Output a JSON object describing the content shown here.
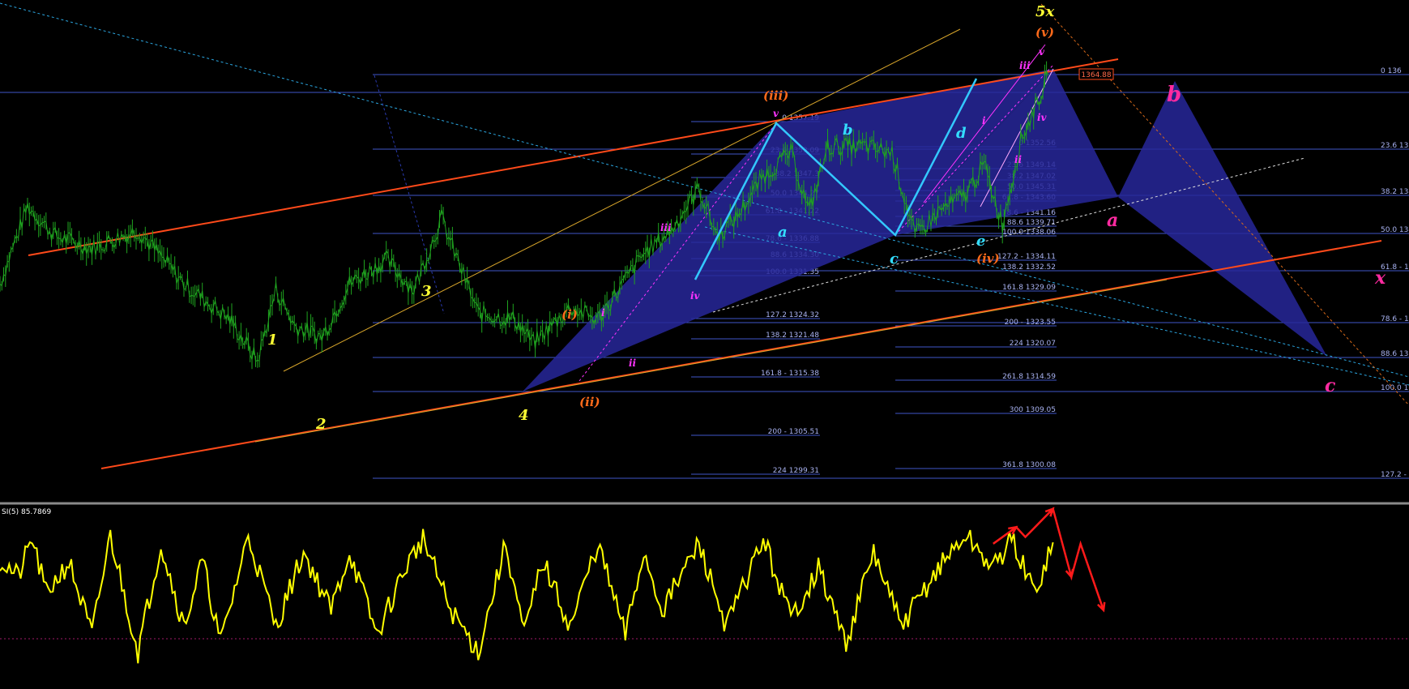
{
  "indicator": {
    "label": "SI(5) 85.7869"
  },
  "price_tag": "1364.88",
  "colors": {
    "background": "#000000",
    "candles": "#1fa31f",
    "trendline": "#ff4a1a",
    "channel": "#d9a62b",
    "fib": "#3f56c8",
    "fib_text": "#a9b3f2",
    "harmonic_fill": "#27279a",
    "zigzag": "#33c8ff",
    "rsi": "#ffff00",
    "forecast": "#ff1a1a",
    "wave_primary": "#ffff33",
    "wave_minor": "#ff6a1a",
    "wave_minute": "#ff33ff",
    "wave_abc": "#33ddff",
    "wave_xabc": "#ff2aa0"
  },
  "fib_right": {
    "labels": [
      "0 136",
      "23.6 135",
      "38.2 134",
      "50.0 134",
      "61.8 - 133",
      "78.6 - 132",
      "88.6 13",
      "100.0 132",
      "127.2 - 129"
    ]
  },
  "fib_set1": {
    "labels": [
      "0 1357.19",
      "23.6 1353.09",
      "38.2 1347.3",
      "50.0 1344.27",
      "61.8 - 1341.22",
      "78.6 - 1336.88",
      "88.6 1334.30",
      "100.0 1331.35",
      "127.2 1324.32",
      "138.2 1321.48",
      "161.8 - 1315.38",
      "200 - 1305.51",
      "224 1299.31"
    ]
  },
  "fib_set2": {
    "labels": [
      "0 1352.56",
      "23.6 1349.14",
      "38.2 1347.02",
      "50.0 1345.31",
      "61.8 - 1343.60",
      "78.6 - 1341.16",
      "88.6 1339.71",
      "100.0 1338.06",
      "127.2 - 1334.11",
      "138.2 1332.52",
      "161.8 1329.09",
      "200 - 1323.55",
      "224 1320.07",
      "261.8 1314.59",
      "300 1309.05",
      "361.8 1300.08"
    ]
  },
  "waves": {
    "primary": [
      "1",
      "2",
      "3",
      "4",
      "5x"
    ],
    "minor": [
      "(i)",
      "(ii)",
      "(iii)",
      "(iv)",
      "(v)"
    ],
    "minute": [
      "i",
      "ii",
      "iii",
      "iv",
      "v"
    ],
    "minute2": [
      "i",
      "ii",
      "iii",
      "iv",
      "v"
    ],
    "abc": [
      "a",
      "b",
      "c",
      "d",
      "e"
    ],
    "xabc": [
      "b",
      "a",
      "x",
      "c"
    ]
  },
  "chart_data": {
    "type": "line",
    "price_series": {
      "x": [
        0,
        30,
        60,
        100,
        150,
        200,
        250,
        280,
        300,
        320,
        350,
        380,
        420,
        450,
        480,
        500,
        520,
        560,
        580,
        620,
        650,
        700,
        730,
        760,
        780,
        800,
        830,
        860,
        880,
        900,
        940,
        970,
        995,
        1020,
        1050,
        1070,
        1090,
        1110,
        1140
      ],
      "y": [
        1330,
        1343,
        1338,
        1336,
        1339,
        1330,
        1324,
        1317,
        1329,
        1323,
        1321,
        1330,
        1334,
        1329,
        1341,
        1333,
        1325,
        1324,
        1320,
        1326,
        1324,
        1335,
        1339,
        1346,
        1338,
        1341,
        1348,
        1352,
        1342,
        1353,
        1353,
        1352,
        1338,
        1342,
        1345,
        1350,
        1340,
        1354,
        1364.88
      ]
    },
    "indicator_series": {
      "name": "SI(5)",
      "x": [
        0,
        20,
        35,
        50,
        75,
        100,
        120,
        150,
        175,
        200,
        220,
        240,
        270,
        300,
        330,
        360,
        380,
        410,
        440,
        460,
        490,
        520,
        550,
        570,
        590,
        620,
        650,
        680,
        700,
        720,
        760,
        790,
        830,
        860,
        890,
        920,
        950,
        980,
        1020,
        1050,
        1080,
        1100,
        1125,
        1145
      ],
      "y": [
        75,
        65,
        88,
        55,
        74,
        30,
        90,
        20,
        85,
        35,
        75,
        25,
        90,
        35,
        80,
        45,
        80,
        30,
        70,
        88,
        45,
        20,
        85,
        30,
        75,
        35,
        85,
        30,
        80,
        45,
        85,
        35,
        88,
        40,
        70,
        25,
        80,
        35,
        70,
        90,
        70,
        88,
        55,
        85.7869
      ],
      "ylim": [
        0,
        100
      ]
    },
    "forecast": {
      "rsi_path": [
        [
          1080,
          85
        ],
        [
          1105,
          95
        ],
        [
          1115,
          89
        ],
        [
          1145,
          106
        ],
        [
          1165,
          65
        ],
        [
          1175,
          85
        ],
        [
          1200,
          45
        ]
      ]
    }
  }
}
